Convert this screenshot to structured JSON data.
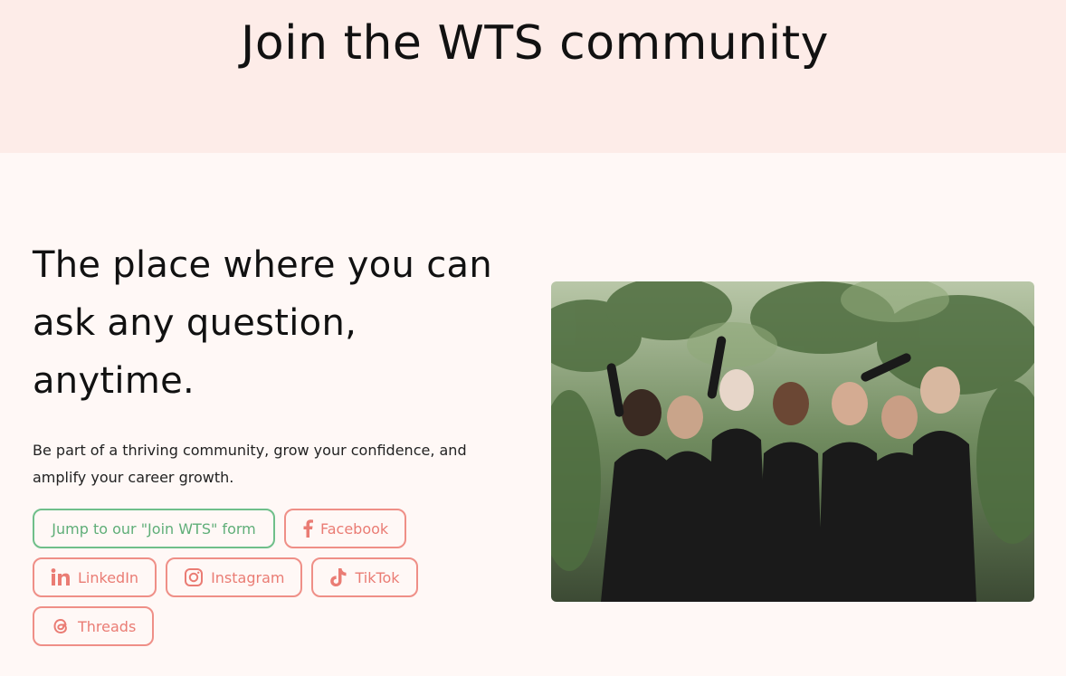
{
  "hero": {
    "title": "Join the WTS community"
  },
  "main": {
    "heading": "The place where you can ask any question, anytime.",
    "description": "Be part of a thriving community, grow your confidence, and amplify your career growth."
  },
  "buttons": {
    "join_form": "Jump to our \"Join WTS\" form",
    "facebook": "Facebook",
    "linkedin": "LinkedIn",
    "instagram": "Instagram",
    "tiktok": "TikTok",
    "threads": "Threads"
  },
  "colors": {
    "hero_bg": "#fdece8",
    "page_bg": "#fff8f6",
    "accent_coral": "#ef8f87",
    "accent_green": "#6fbf8a"
  },
  "photo": {
    "icon": "group-photo"
  }
}
